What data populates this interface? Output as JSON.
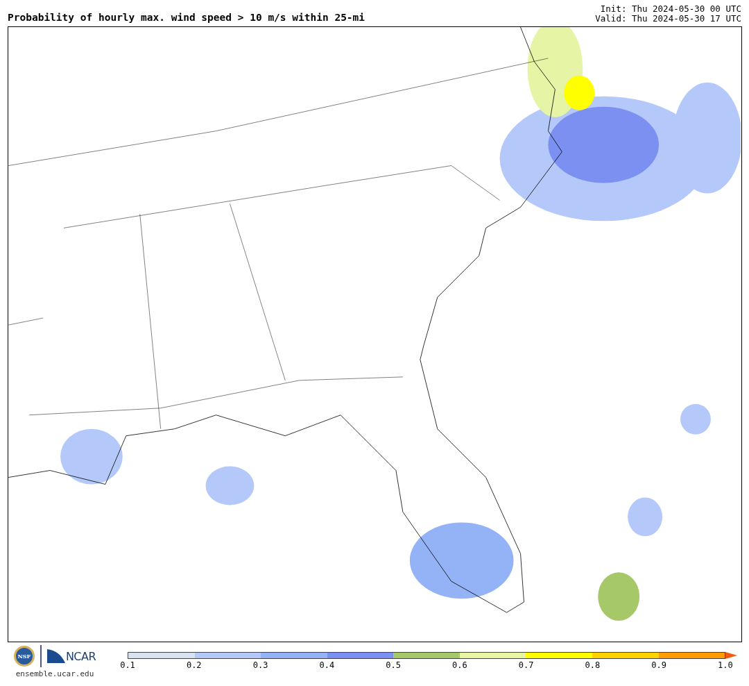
{
  "title": "Probability of hourly max. wind speed > 10 m/s within 25-mi",
  "init": "Init: Thu 2024-05-30 00 UTC",
  "valid": "Valid: Thu 2024-05-30 17 UTC",
  "logos": {
    "nsf": "NSF",
    "ncar": "NCAR",
    "url": "ensemble.ucar.edu"
  },
  "colorbar": {
    "segments": [
      {
        "color": "#d6e2ee"
      },
      {
        "color": "#b4c8fa"
      },
      {
        "color": "#94b2f6"
      },
      {
        "color": "#7b90f0"
      },
      {
        "color": "#a6c868"
      },
      {
        "color": "#e6f4a6"
      },
      {
        "color": "#ffff00"
      },
      {
        "color": "#ffd200"
      },
      {
        "color": "#ff9c00"
      }
    ],
    "extend": {
      "color": "#f05a14"
    },
    "ticks": [
      "0.1",
      "0.2",
      "0.3",
      "0.4",
      "0.5",
      "0.6",
      "0.7",
      "0.8",
      "0.9",
      "1.0"
    ]
  }
}
